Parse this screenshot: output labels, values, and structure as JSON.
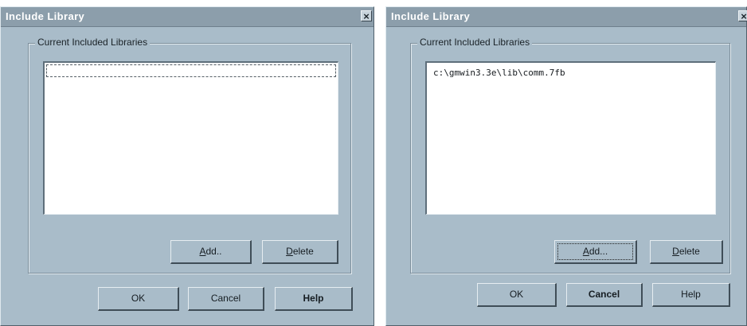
{
  "dialogs": [
    {
      "title": "Include Library",
      "close_symbol": "×",
      "group_label": "Current Included Libraries",
      "list_items": [],
      "buttons": {
        "add_mnemonic": "A",
        "add_rest": "dd..",
        "delete_mnemonic": "D",
        "delete_rest": "elete",
        "ok": "OK",
        "cancel": "Cancel",
        "help": "Help"
      }
    },
    {
      "title": "Include Library",
      "close_symbol": "×",
      "group_label": "Current Included Libraries",
      "list_items": [
        "c:\\gmwin3.3e\\lib\\comm.7fb"
      ],
      "buttons": {
        "add_mnemonic": "A",
        "add_rest": "dd...",
        "delete_mnemonic": "D",
        "delete_rest": "elete",
        "ok": "OK",
        "cancel": "Cancel",
        "help": "Help"
      }
    }
  ]
}
